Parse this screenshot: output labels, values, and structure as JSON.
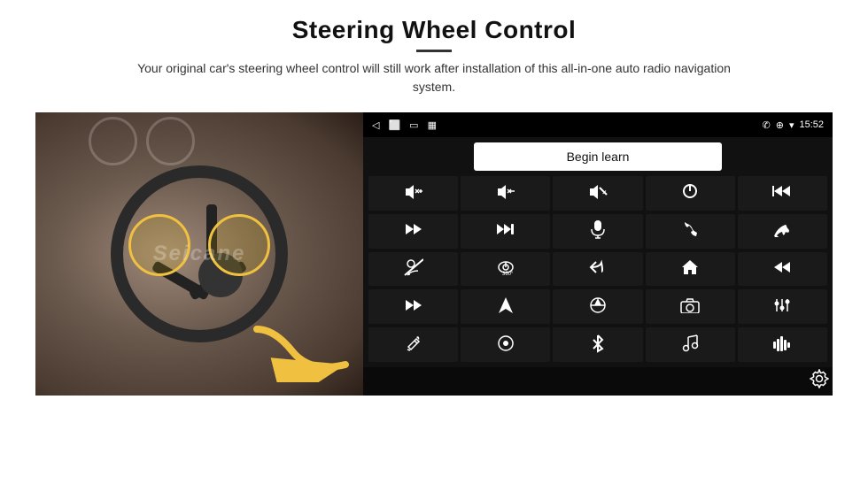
{
  "header": {
    "title": "Steering Wheel Control",
    "subtitle": "Your original car's steering wheel control will still work after installation of this all-in-one auto radio navigation system."
  },
  "status_bar": {
    "time": "15:52",
    "nav_icon": "◁",
    "home_icon": "⬜",
    "square_icon": "▭",
    "signal_icon": "▦",
    "phone_icon": "✆",
    "location_icon": "⊕",
    "wifi_icon": "▾"
  },
  "begin_learn_label": "Begin learn",
  "grid_rows": [
    [
      {
        "icon": "🔊+",
        "name": "vol-up"
      },
      {
        "icon": "🔊−",
        "name": "vol-down"
      },
      {
        "icon": "🔇",
        "name": "mute"
      },
      {
        "icon": "⏻",
        "name": "power"
      },
      {
        "icon": "⏮",
        "name": "prev-track"
      }
    ],
    [
      {
        "icon": "⏭",
        "name": "next-track"
      },
      {
        "icon": "⏭",
        "name": "fast-forward"
      },
      {
        "icon": "🎤",
        "name": "mic"
      },
      {
        "icon": "📞",
        "name": "phone"
      },
      {
        "icon": "📵",
        "name": "hang-up"
      }
    ],
    [
      {
        "icon": "🔕",
        "name": "mute2"
      },
      {
        "icon": "🔄",
        "name": "360"
      },
      {
        "icon": "↩",
        "name": "back"
      },
      {
        "icon": "🏠",
        "name": "home"
      },
      {
        "icon": "⏮",
        "name": "rewind"
      }
    ],
    [
      {
        "icon": "⏭",
        "name": "skip"
      },
      {
        "icon": "➤",
        "name": "navigate"
      },
      {
        "icon": "⊕",
        "name": "swap"
      },
      {
        "icon": "📷",
        "name": "camera"
      },
      {
        "icon": "🎛",
        "name": "equalizer"
      }
    ],
    [
      {
        "icon": "✏",
        "name": "edit"
      },
      {
        "icon": "⊙",
        "name": "circle-dot"
      },
      {
        "icon": "✦",
        "name": "bluetooth"
      },
      {
        "icon": "♪",
        "name": "music"
      },
      {
        "icon": "📊",
        "name": "audio-viz"
      }
    ]
  ],
  "settings_icon": "⚙",
  "watermark": "Seicane"
}
